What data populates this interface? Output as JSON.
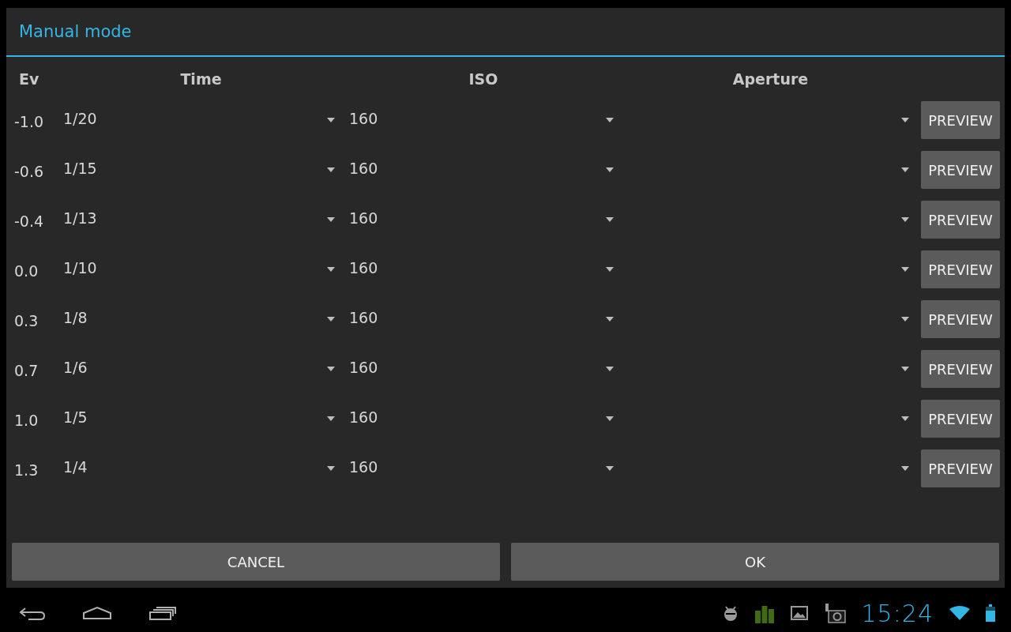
{
  "dialog": {
    "title": "Manual mode"
  },
  "columns": [
    "Ev",
    "Time",
    "ISO",
    "Aperture"
  ],
  "rows": [
    {
      "ev": "-1.0",
      "time": "1/20",
      "iso": "160",
      "action": "PREVIEW"
    },
    {
      "ev": "-0.6",
      "time": "1/15",
      "iso": "160",
      "action": "PREVIEW"
    },
    {
      "ev": "-0.4",
      "time": "1/13",
      "iso": "160",
      "action": "PREVIEW"
    },
    {
      "ev": "0.0",
      "time": "1/10",
      "iso": "160",
      "action": "PREVIEW"
    },
    {
      "ev": "0.3",
      "time": "1/8",
      "iso": "160",
      "action": "PREVIEW"
    },
    {
      "ev": "0.7",
      "time": "1/6",
      "iso": "160",
      "action": "PREVIEW"
    },
    {
      "ev": "1.0",
      "time": "1/5",
      "iso": "160",
      "action": "PREVIEW"
    },
    {
      "ev": "1.3",
      "time": "1/4",
      "iso": "160",
      "action": "PREVIEW"
    }
  ],
  "buttons": [
    "CANCEL",
    "OK"
  ],
  "status_bar": {
    "time": "15:24"
  }
}
